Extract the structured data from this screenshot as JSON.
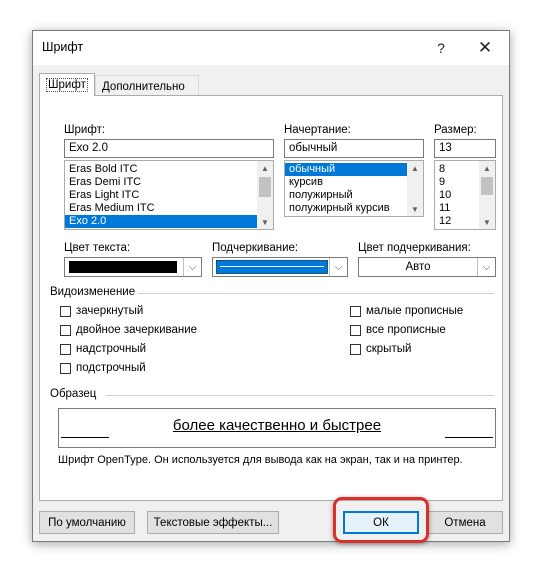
{
  "dialog": {
    "title": "Шрифт",
    "help_glyph": "?",
    "close_glyph": "✕"
  },
  "tabs": [
    {
      "label": "Шрифт",
      "active": true
    },
    {
      "label": "Дополнительно",
      "active": false
    }
  ],
  "font": {
    "label": "Шрифт:",
    "value": "Exo 2.0",
    "options": [
      "Eras Bold ITC",
      "Eras Demi ITC",
      "Eras Light ITC",
      "Eras Medium ITC",
      "Exo 2.0"
    ],
    "selected": "Exo 2.0"
  },
  "style": {
    "label": "Начертание:",
    "value": "обычный",
    "options": [
      "обычный",
      "курсив",
      "полужирный",
      "полужирный курсив"
    ],
    "selected": "обычный"
  },
  "size": {
    "label": "Размер:",
    "value": "13",
    "options": [
      "8",
      "9",
      "10",
      "11",
      "12"
    ]
  },
  "text_color": {
    "label": "Цвет текста:",
    "swatch": "#000000"
  },
  "underline": {
    "label": "Подчеркивание:"
  },
  "underline_color": {
    "label": "Цвет подчеркивания:",
    "value": "Авто"
  },
  "effects": {
    "heading": "Видоизменение",
    "left": [
      {
        "label": "зачеркнутый",
        "checked": false
      },
      {
        "label": "двойное зачеркивание",
        "checked": false
      },
      {
        "label": "надстрочный",
        "checked": false
      },
      {
        "label": "подстрочный",
        "checked": false
      }
    ],
    "right": [
      {
        "label": "малые прописные",
        "checked": false
      },
      {
        "label": "все прописные",
        "checked": false
      },
      {
        "label": "скрытый",
        "checked": false
      }
    ]
  },
  "preview": {
    "heading": "Образец",
    "sample": "более качественно и быстрее",
    "info": "Шрифт OpenType. Он используется для вывода как на экран, так и на принтер."
  },
  "buttons": {
    "default": "По умолчанию",
    "text_effects": "Текстовые эффекты...",
    "ok": "ОК",
    "cancel": "Отмена"
  },
  "colors": {
    "selection": "#0078d7",
    "highlight": "#d9302c"
  }
}
